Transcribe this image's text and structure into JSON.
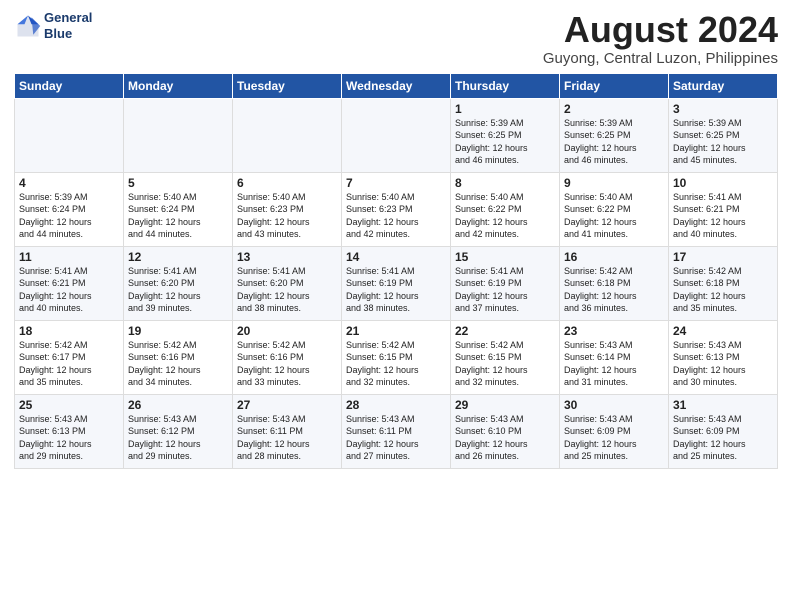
{
  "header": {
    "logo_line1": "General",
    "logo_line2": "Blue",
    "month": "August 2024",
    "location": "Guyong, Central Luzon, Philippines"
  },
  "days_of_week": [
    "Sunday",
    "Monday",
    "Tuesday",
    "Wednesday",
    "Thursday",
    "Friday",
    "Saturday"
  ],
  "weeks": [
    [
      {
        "day": "",
        "text": ""
      },
      {
        "day": "",
        "text": ""
      },
      {
        "day": "",
        "text": ""
      },
      {
        "day": "",
        "text": ""
      },
      {
        "day": "1",
        "text": "Sunrise: 5:39 AM\nSunset: 6:25 PM\nDaylight: 12 hours\nand 46 minutes."
      },
      {
        "day": "2",
        "text": "Sunrise: 5:39 AM\nSunset: 6:25 PM\nDaylight: 12 hours\nand 46 minutes."
      },
      {
        "day": "3",
        "text": "Sunrise: 5:39 AM\nSunset: 6:25 PM\nDaylight: 12 hours\nand 45 minutes."
      }
    ],
    [
      {
        "day": "4",
        "text": "Sunrise: 5:39 AM\nSunset: 6:24 PM\nDaylight: 12 hours\nand 44 minutes."
      },
      {
        "day": "5",
        "text": "Sunrise: 5:40 AM\nSunset: 6:24 PM\nDaylight: 12 hours\nand 44 minutes."
      },
      {
        "day": "6",
        "text": "Sunrise: 5:40 AM\nSunset: 6:23 PM\nDaylight: 12 hours\nand 43 minutes."
      },
      {
        "day": "7",
        "text": "Sunrise: 5:40 AM\nSunset: 6:23 PM\nDaylight: 12 hours\nand 42 minutes."
      },
      {
        "day": "8",
        "text": "Sunrise: 5:40 AM\nSunset: 6:22 PM\nDaylight: 12 hours\nand 42 minutes."
      },
      {
        "day": "9",
        "text": "Sunrise: 5:40 AM\nSunset: 6:22 PM\nDaylight: 12 hours\nand 41 minutes."
      },
      {
        "day": "10",
        "text": "Sunrise: 5:41 AM\nSunset: 6:21 PM\nDaylight: 12 hours\nand 40 minutes."
      }
    ],
    [
      {
        "day": "11",
        "text": "Sunrise: 5:41 AM\nSunset: 6:21 PM\nDaylight: 12 hours\nand 40 minutes."
      },
      {
        "day": "12",
        "text": "Sunrise: 5:41 AM\nSunset: 6:20 PM\nDaylight: 12 hours\nand 39 minutes."
      },
      {
        "day": "13",
        "text": "Sunrise: 5:41 AM\nSunset: 6:20 PM\nDaylight: 12 hours\nand 38 minutes."
      },
      {
        "day": "14",
        "text": "Sunrise: 5:41 AM\nSunset: 6:19 PM\nDaylight: 12 hours\nand 38 minutes."
      },
      {
        "day": "15",
        "text": "Sunrise: 5:41 AM\nSunset: 6:19 PM\nDaylight: 12 hours\nand 37 minutes."
      },
      {
        "day": "16",
        "text": "Sunrise: 5:42 AM\nSunset: 6:18 PM\nDaylight: 12 hours\nand 36 minutes."
      },
      {
        "day": "17",
        "text": "Sunrise: 5:42 AM\nSunset: 6:18 PM\nDaylight: 12 hours\nand 35 minutes."
      }
    ],
    [
      {
        "day": "18",
        "text": "Sunrise: 5:42 AM\nSunset: 6:17 PM\nDaylight: 12 hours\nand 35 minutes."
      },
      {
        "day": "19",
        "text": "Sunrise: 5:42 AM\nSunset: 6:16 PM\nDaylight: 12 hours\nand 34 minutes."
      },
      {
        "day": "20",
        "text": "Sunrise: 5:42 AM\nSunset: 6:16 PM\nDaylight: 12 hours\nand 33 minutes."
      },
      {
        "day": "21",
        "text": "Sunrise: 5:42 AM\nSunset: 6:15 PM\nDaylight: 12 hours\nand 32 minutes."
      },
      {
        "day": "22",
        "text": "Sunrise: 5:42 AM\nSunset: 6:15 PM\nDaylight: 12 hours\nand 32 minutes."
      },
      {
        "day": "23",
        "text": "Sunrise: 5:43 AM\nSunset: 6:14 PM\nDaylight: 12 hours\nand 31 minutes."
      },
      {
        "day": "24",
        "text": "Sunrise: 5:43 AM\nSunset: 6:13 PM\nDaylight: 12 hours\nand 30 minutes."
      }
    ],
    [
      {
        "day": "25",
        "text": "Sunrise: 5:43 AM\nSunset: 6:13 PM\nDaylight: 12 hours\nand 29 minutes."
      },
      {
        "day": "26",
        "text": "Sunrise: 5:43 AM\nSunset: 6:12 PM\nDaylight: 12 hours\nand 29 minutes."
      },
      {
        "day": "27",
        "text": "Sunrise: 5:43 AM\nSunset: 6:11 PM\nDaylight: 12 hours\nand 28 minutes."
      },
      {
        "day": "28",
        "text": "Sunrise: 5:43 AM\nSunset: 6:11 PM\nDaylight: 12 hours\nand 27 minutes."
      },
      {
        "day": "29",
        "text": "Sunrise: 5:43 AM\nSunset: 6:10 PM\nDaylight: 12 hours\nand 26 minutes."
      },
      {
        "day": "30",
        "text": "Sunrise: 5:43 AM\nSunset: 6:09 PM\nDaylight: 12 hours\nand 25 minutes."
      },
      {
        "day": "31",
        "text": "Sunrise: 5:43 AM\nSunset: 6:09 PM\nDaylight: 12 hours\nand 25 minutes."
      }
    ]
  ]
}
